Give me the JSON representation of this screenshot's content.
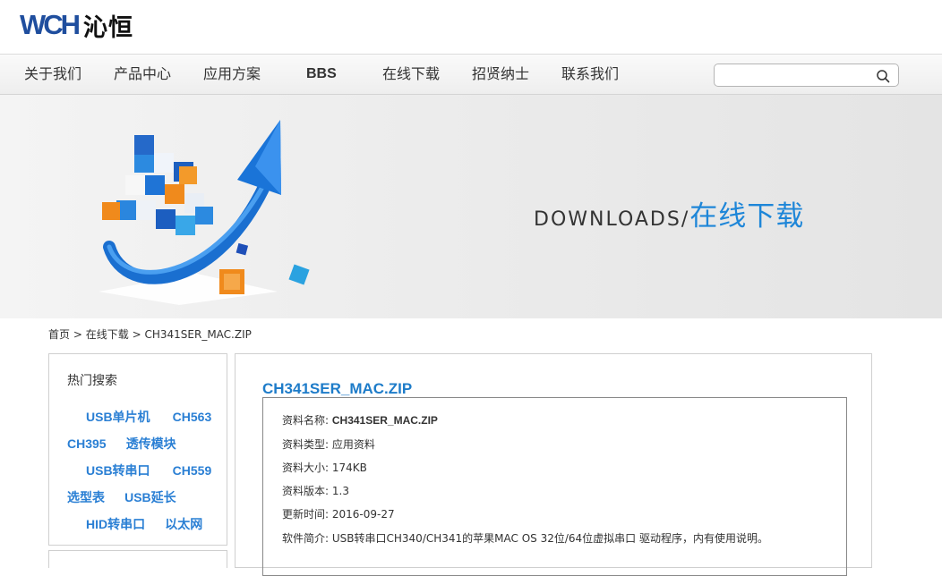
{
  "header": {
    "logo_mark": "WCH",
    "logo_text": "沁恒"
  },
  "nav": {
    "items": [
      "关于我们",
      "产品中心",
      "应用方案",
      "BBS",
      "在线下载",
      "招贤纳士",
      "联系我们"
    ],
    "search_value": ""
  },
  "banner": {
    "title_en": "DOWNLOADS",
    "separator": "/",
    "title_cn": "在线下载"
  },
  "breadcrumb": {
    "home": "首页",
    "sep": ">",
    "section": "在线下载",
    "current": "CH341SER_MAC.ZIP"
  },
  "sidebar": {
    "title": "热门搜索",
    "tags": [
      "USB单片机",
      "CH563",
      "CH395",
      "透传模块",
      "USB转串口",
      "CH559",
      "选型表",
      "USB延长",
      "HID转串口",
      "以太网"
    ]
  },
  "file": {
    "title": "CH341SER_MAC.ZIP",
    "rows": [
      {
        "label": "资料名称:",
        "value": "CH341SER_MAC.ZIP"
      },
      {
        "label": "资料类型:",
        "value": "应用资料"
      },
      {
        "label": "资料大小:",
        "value": "174KB"
      },
      {
        "label": "资料版本:",
        "value": "1.3"
      },
      {
        "label": "更新时间:",
        "value": "2016-09-27"
      },
      {
        "label": "软件简介:",
        "value": "USB转串口CH340/CH341的苹果MAC OS 32位/64位虚拟串口 驱动程序，内有使用说明。"
      }
    ]
  },
  "colors": {
    "accent": "#1e86d8",
    "link": "#2a7fd4",
    "logo": "#1f4e9e"
  }
}
